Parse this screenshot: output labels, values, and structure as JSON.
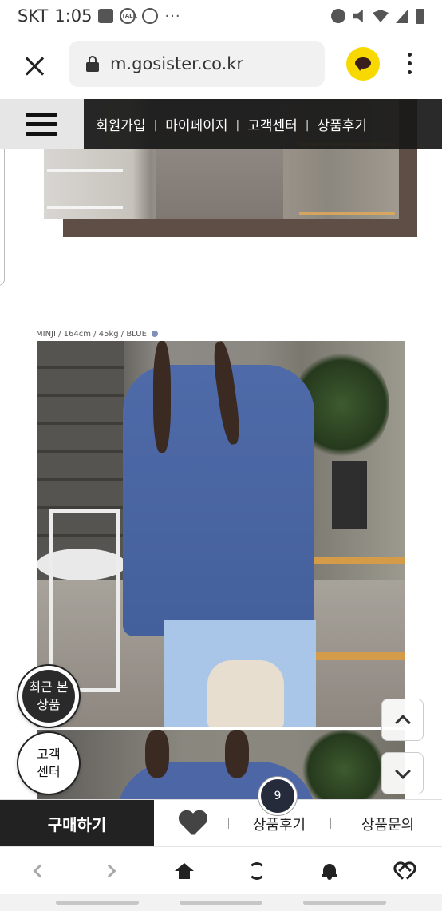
{
  "status_bar": {
    "carrier": "SKT",
    "time": "1:05",
    "talk_badge": "TALK",
    "overflow": "···"
  },
  "browser": {
    "url": "m.gosister.co.kr"
  },
  "top_nav": {
    "items": [
      {
        "label": "회원가입"
      },
      {
        "label": "마이페이지"
      },
      {
        "label": "고객센터"
      },
      {
        "label": "상품후기"
      }
    ],
    "separator": "|"
  },
  "product": {
    "model_caption": "MINJI / 164cm / 45kg / BLUE"
  },
  "floating": {
    "recent_line1": "최근 본",
    "recent_line2": "상품",
    "cs_line1": "고객",
    "cs_line2": "센터"
  },
  "purchase_bar": {
    "buy_label": "구매하기",
    "review_label": "상품후기",
    "review_count": "9",
    "inquiry_label": "상품문의"
  },
  "colors": {
    "frame": "#5e4e45",
    "nav_background": "#181818",
    "buy_button": "#222222",
    "kakao": "#f7d900",
    "review_badge": "#262b3c"
  }
}
